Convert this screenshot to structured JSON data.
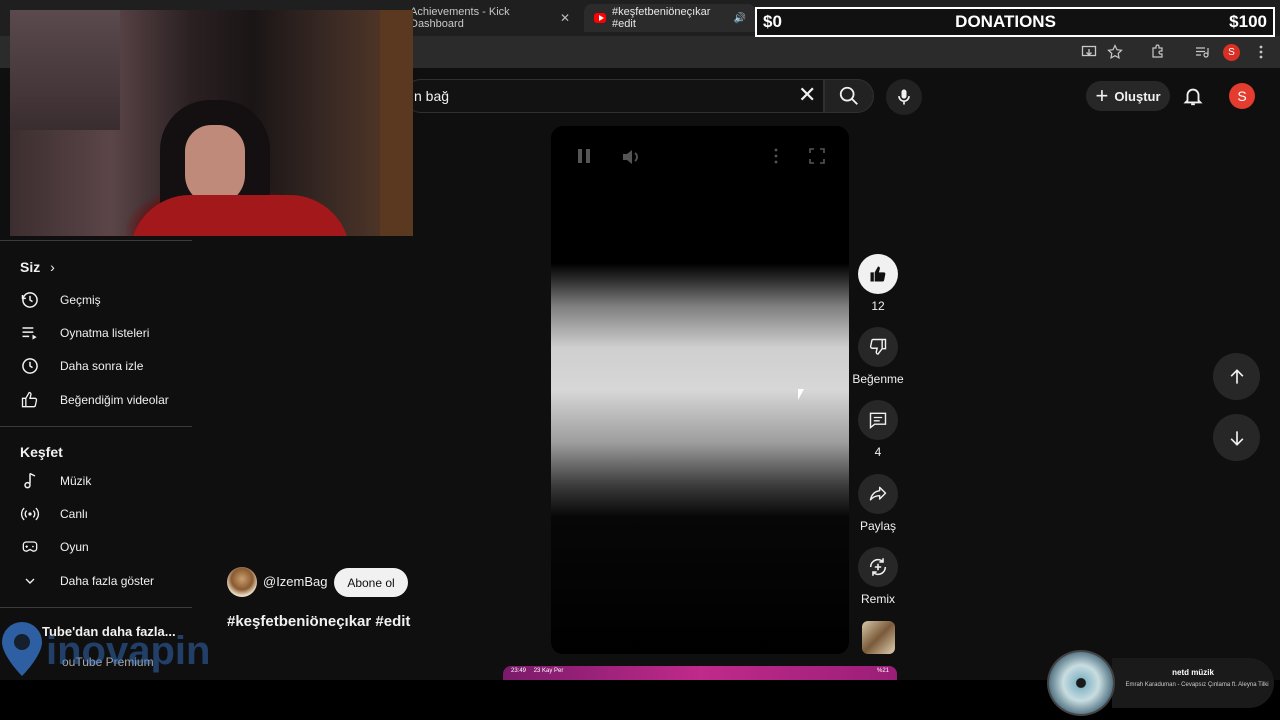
{
  "tabs": [
    {
      "label": "Achievements - Kick Dashboard",
      "close": "✕"
    },
    {
      "label": "#keşfetbeniöneçıkar #edit",
      "close": "✕"
    }
  ],
  "donations": {
    "left_amount": "$0",
    "title": "DONATIONS",
    "right_amount": "$100"
  },
  "header": {
    "search_value": "n bağ",
    "create_label": "Oluştur",
    "avatar_letter": "S",
    "browser_profile_letter": "S"
  },
  "sidebar": {
    "you_section": {
      "title": "Siz",
      "items": [
        {
          "label": "Geçmiş",
          "icon": "history-icon"
        },
        {
          "label": "Oynatma listeleri",
          "icon": "playlist-icon"
        },
        {
          "label": "Daha sonra izle",
          "icon": "clock-icon"
        },
        {
          "label": "Beğendiğim videolar",
          "icon": "thumbs-up-icon"
        }
      ]
    },
    "explore_section": {
      "title": "Keşfet",
      "items": [
        {
          "label": "Müzik",
          "icon": "music-note-icon"
        },
        {
          "label": "Canlı",
          "icon": "live-icon"
        },
        {
          "label": "Oyun",
          "icon": "gamepad-icon"
        },
        {
          "label": "Daha fazla göster",
          "icon": "chevron-down-icon"
        }
      ]
    },
    "more_title": "Tube'dan daha fazla...",
    "more_sub": "ouTube Premium",
    "watermark_text": "inovapin"
  },
  "short": {
    "channel": "@IzemBag",
    "subscribe_label": "Abone ol",
    "title": "#keşfetbeniöneçıkar #edit"
  },
  "actions": {
    "like_count": "12",
    "dislike_label": "Beğenme",
    "comment_count": "4",
    "share_label": "Paylaş",
    "remix_label": "Remix"
  },
  "next_preview": {
    "time": "23:49",
    "date": "23 Kay Per",
    "status": "%21"
  },
  "now_playing": {
    "title": "netd müzik",
    "song": "Emrah Karaduman - Cevapsız Çınlama ft. Aleyna Tilki"
  },
  "colors": {
    "accent_red": "#ff0000",
    "avatar_red": "#e43c2f",
    "background": "#0f0f0f"
  }
}
